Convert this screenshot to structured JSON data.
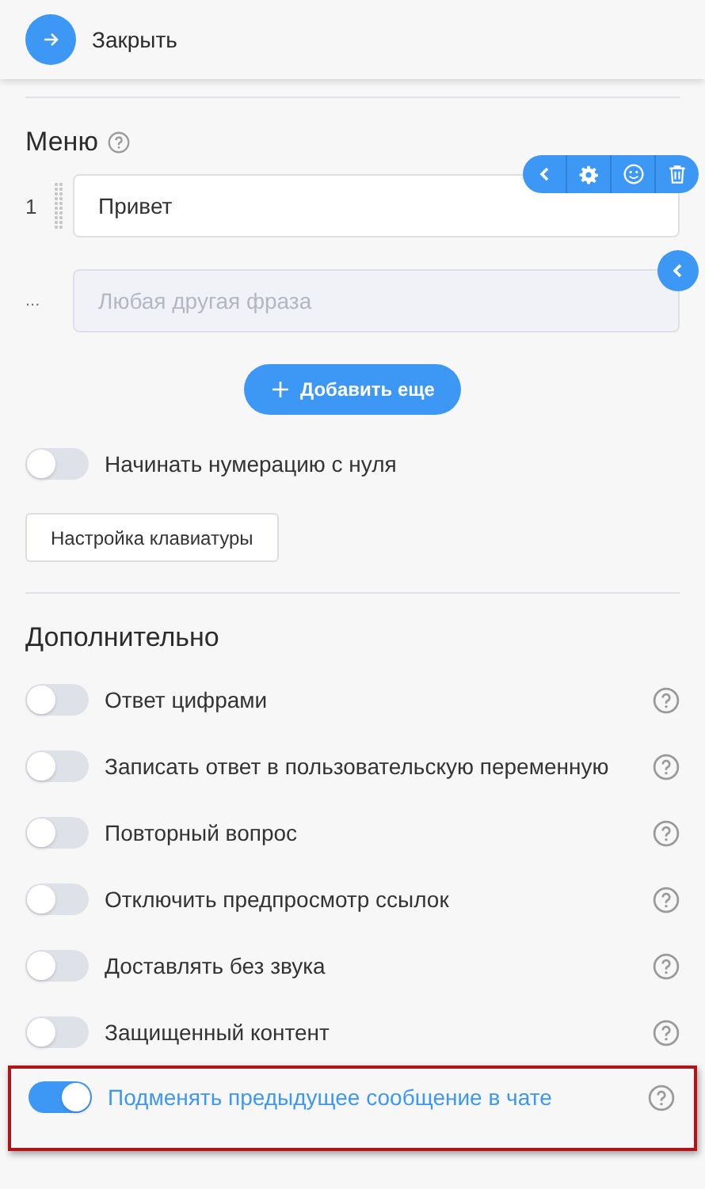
{
  "header": {
    "close_label": "Закрыть"
  },
  "menu": {
    "title": "Меню",
    "items": [
      {
        "number": "1",
        "value": "Привет"
      }
    ],
    "fallback": {
      "number": "...",
      "placeholder": "Любая другая фраза"
    },
    "add_button": "Добавить еще",
    "zero_numbering": {
      "label": "Начинать нумерацию с нуля",
      "on": false
    },
    "keyboard_button": "Настройка клавиатуры"
  },
  "extra": {
    "title": "Дополнительно",
    "options": [
      {
        "label": "Ответ цифрами",
        "on": false,
        "highlighted": false
      },
      {
        "label": "Записать ответ в пользовательскую переменную",
        "on": false,
        "highlighted": false
      },
      {
        "label": "Повторный вопрос",
        "on": false,
        "highlighted": false
      },
      {
        "label": "Отключить предпросмотр ссылок",
        "on": false,
        "highlighted": false
      },
      {
        "label": "Доставлять без звука",
        "on": false,
        "highlighted": false
      },
      {
        "label": "Защищенный контент",
        "on": false,
        "highlighted": false
      },
      {
        "label": "Подменять предыдущее сообщение в чате",
        "on": true,
        "highlighted": true
      }
    ]
  }
}
